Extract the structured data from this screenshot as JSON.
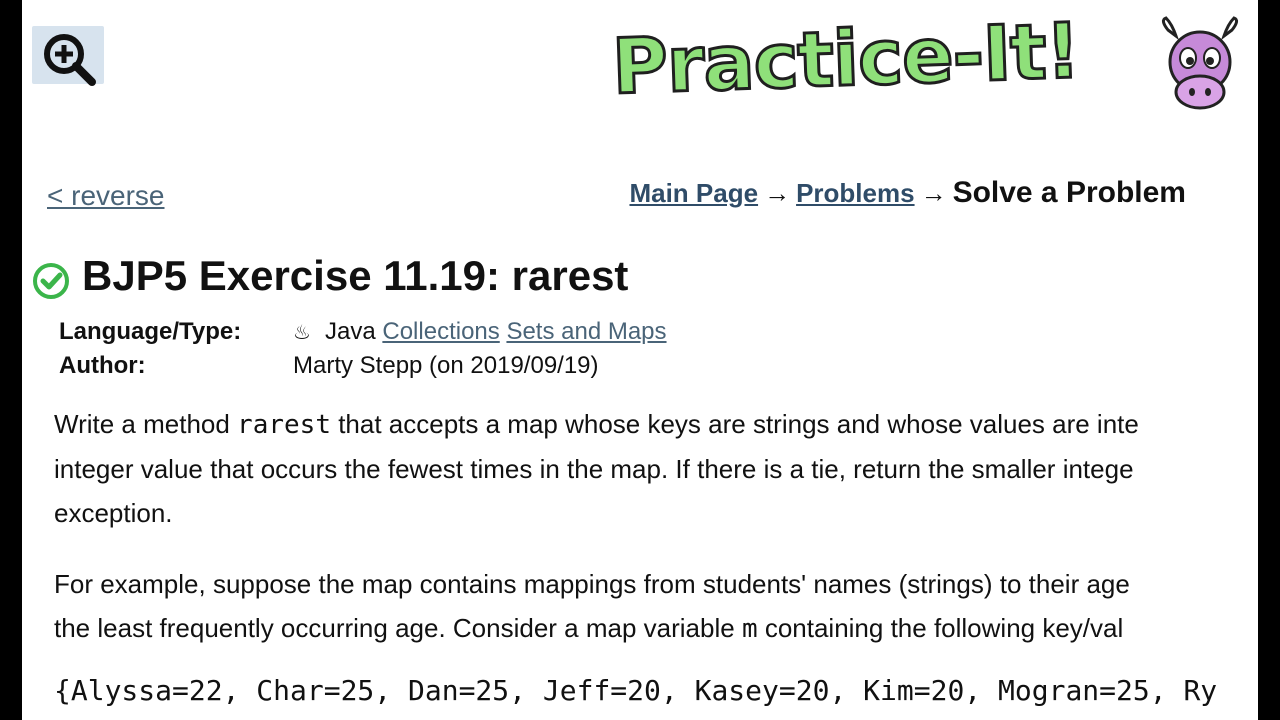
{
  "toolbar": {
    "zoom_icon": "zoom-in-icon"
  },
  "logo": {
    "text": "Practice-It!",
    "mascot": "cow-mascot-icon"
  },
  "nav": {
    "back_link": "< reverse",
    "breadcrumb": {
      "main_page": "Main Page",
      "problems": "Problems",
      "current": "Solve a Problem",
      "separator": "→"
    }
  },
  "problem": {
    "status_icon": "solved-check-icon",
    "title": "BJP5 Exercise 11.19: rarest",
    "language_label": "Language/Type:",
    "language": "Java",
    "tags": [
      "Collections",
      "Sets and Maps"
    ],
    "author_label": "Author:",
    "author": "Marty Stepp (on 2019/09/19)"
  },
  "description": {
    "p1_line1_before": "Write a method ",
    "p1_method": "rarest",
    "p1_line1_after": " that accepts a map whose keys are strings and whose values are inte",
    "p1_line2": "integer value that occurs the fewest times in the map. If there is a tie, return the smaller intege",
    "p1_line3": "exception.",
    "p2_line1": "For example, suppose the map contains mappings from students' names (strings) to their age",
    "p2_line2_before": "the least frequently occurring age. Consider a map variable ",
    "p2_var": "m",
    "p2_line2_after": " containing the following key/val",
    "code_line": "{Alyssa=22, Char=25, Dan=25, Jeff=20, Kasey=20, Kim=20, Mogran=25, Ry"
  },
  "colors": {
    "link": "#4a6478",
    "breadcrumb_link": "#2f4c68",
    "logo_fill": "#8fe07a",
    "check": "#3bb54a",
    "zoom_bg": "#d7e3ee"
  }
}
